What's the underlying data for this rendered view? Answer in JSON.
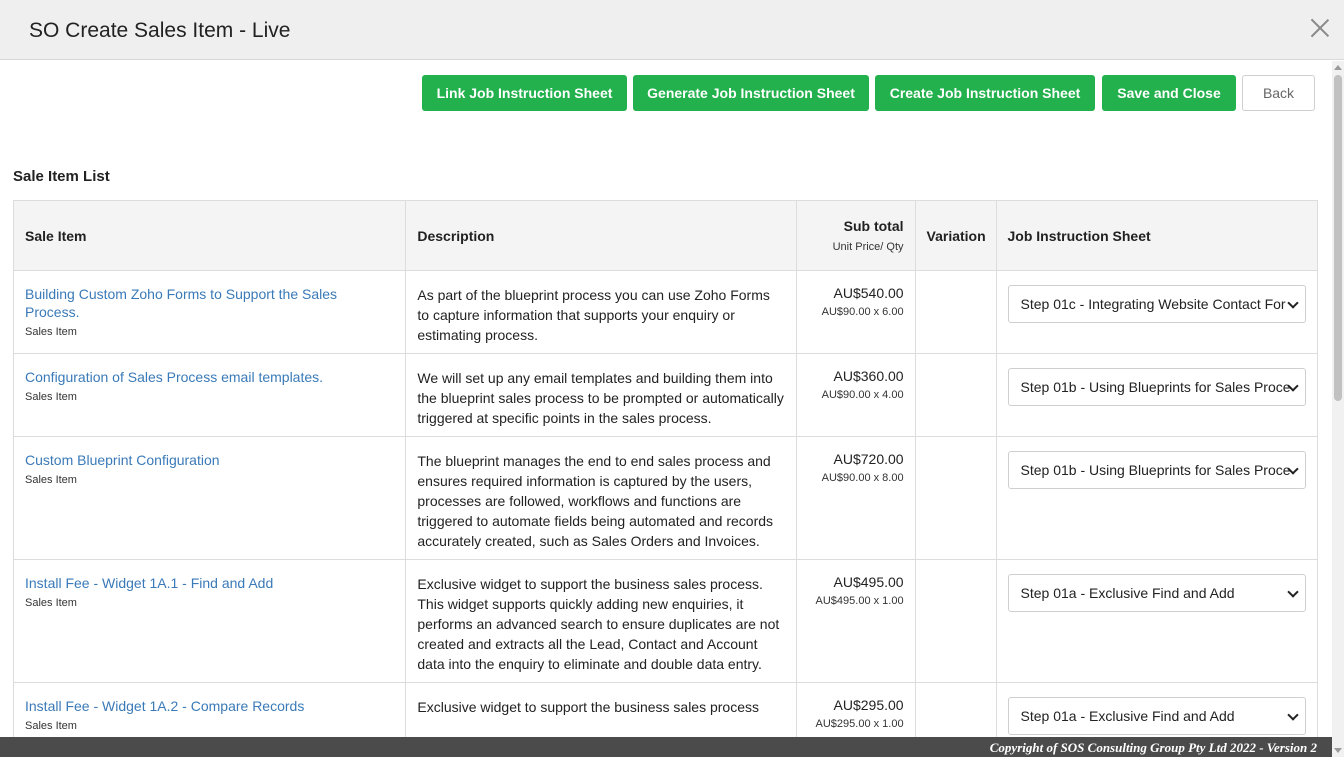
{
  "window": {
    "title": "SO Create Sales Item - Live"
  },
  "toolbar": {
    "link_label": "Link Job Instruction Sheet",
    "generate_label": "Generate Job Instruction Sheet",
    "create_label": "Create Job Instruction Sheet",
    "save_close_label": "Save and Close",
    "back_label": "Back"
  },
  "section_title": "Sale Item List",
  "table": {
    "headers": {
      "sale_item": "Sale Item",
      "description": "Description",
      "subtotal": "Sub total",
      "subtotal_sub": "Unit Price/ Qty",
      "variation": "Variation",
      "job_sheet": "Job Instruction Sheet"
    },
    "rows": [
      {
        "name": "Building Custom Zoho Forms to Support the Sales Process.",
        "type": "Sales Item",
        "description": "As part of the blueprint process you can use Zoho Forms to capture information that supports your enquiry or estimating process.",
        "subtotal": "AU$540.00",
        "unit_qty": "AU$90.00 x 6.00",
        "variation": "",
        "job_sheet": "Step 01c - Integrating Website Contact For"
      },
      {
        "name": "Configuration of Sales Process email templates.",
        "type": "Sales Item",
        "description": "We will set up any email templates and building them into the blueprint sales process to be prompted or automatically triggered at specific points in the sales process.",
        "subtotal": "AU$360.00",
        "unit_qty": "AU$90.00 x 4.00",
        "variation": "",
        "job_sheet": "Step 01b - Using Blueprints for Sales Proce"
      },
      {
        "name": "Custom Blueprint Configuration",
        "type": "Sales Item",
        "description": "The blueprint manages the end to end sales process and ensures required information is captured by the users, processes are followed, workflows and functions are triggered to automate fields being automated and records accurately created, such as Sales Orders and Invoices.",
        "subtotal": "AU$720.00",
        "unit_qty": "AU$90.00 x 8.00",
        "variation": "",
        "job_sheet": "Step 01b - Using Blueprints for Sales Proce"
      },
      {
        "name": "Install Fee - Widget 1A.1 - Find and Add",
        "type": "Sales Item",
        "description": "Exclusive widget to support the business sales process. This widget supports quickly adding new enquiries, it performs an advanced search to ensure duplicates are not created and extracts all the Lead, Contact and Account data into the enquiry to eliminate and double data entry.",
        "subtotal": "AU$495.00",
        "unit_qty": "AU$495.00 x 1.00",
        "variation": "",
        "job_sheet": "Step 01a - Exclusive Find and Add"
      },
      {
        "name": "Install Fee - Widget 1A.2 - Compare Records",
        "type": "Sales Item",
        "description": "Exclusive widget to support the business sales process",
        "subtotal": "AU$295.00",
        "unit_qty": "AU$295.00 x 1.00",
        "variation": "",
        "job_sheet": "Step 01a - Exclusive Find and Add"
      }
    ]
  },
  "footer": {
    "copyright": "Copyright of SOS Consulting Group Pty Ltd 2022 - Version 2"
  },
  "colors": {
    "primary_button": "#22b14c",
    "link": "#3a7ab8",
    "footer_bg": "#4b4b4b"
  }
}
